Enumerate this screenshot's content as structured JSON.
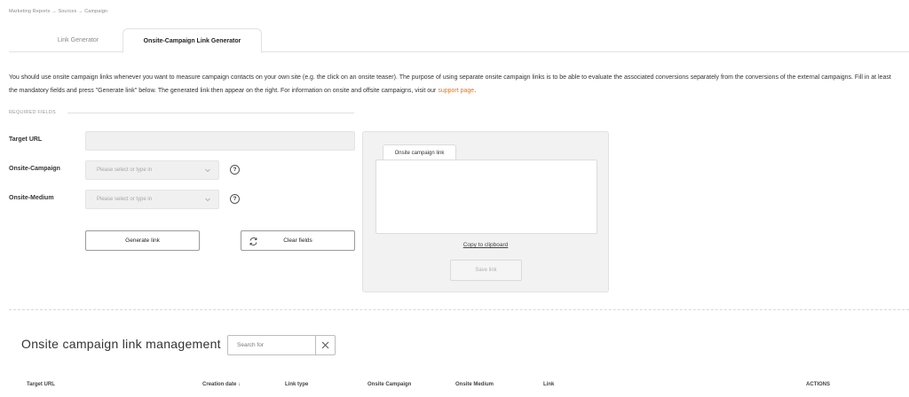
{
  "breadcrumb": "Marketing Reports → Sources → Campaign",
  "tabs": [
    {
      "label": "Link Generator",
      "active": false
    },
    {
      "label": "Onsite-Campaign Link Generator",
      "active": true
    }
  ],
  "intro": {
    "text": "You should use onsite campaign links whenever you want to measure campaign contacts on your own site (e.g. the click on an onsite teaser). The purpose of using separate onsite campaign links is to be able to evaluate the associated conversions separately from the conversions of the external campaigns. Fill in at least the mandatory fields and press \"Generate link\" below. The generated link then appear on the right. For information on onsite and offsite campaigns, visit our ",
    "link_text": "support page",
    "end": "."
  },
  "form": {
    "section_label": "REQUIRED FIELDS",
    "target_url_label": "Target URL",
    "target_url_value": "",
    "campaign_label": "Onsite-Campaign",
    "campaign_placeholder": "Please select or type in",
    "medium_label": "Onsite-Medium",
    "medium_placeholder": "Please select or type in",
    "help_glyph": "?",
    "generate_label": "Generate link",
    "clear_label": "Clear fields"
  },
  "output": {
    "tab_label": "Onsite campaign link",
    "link_value": "",
    "copy_label": "Copy to clipboard",
    "save_label": "Save link"
  },
  "management": {
    "title": "Onsite campaign link management",
    "search_placeholder": "Search for",
    "columns": [
      "Target URL",
      "Creation date",
      "Link type",
      "Onsite Campaign",
      "Onsite Medium",
      "Link",
      "ACTIONS"
    ],
    "sort_glyph": "↓"
  },
  "colors": {
    "accent": "#e8751a",
    "panel_bg": "#f2f2f2",
    "field_bg": "#f0f0f0"
  },
  "icons": [
    "chevron-down-icon",
    "help-icon",
    "refresh-icon",
    "close-icon",
    "sort-down-icon"
  ]
}
